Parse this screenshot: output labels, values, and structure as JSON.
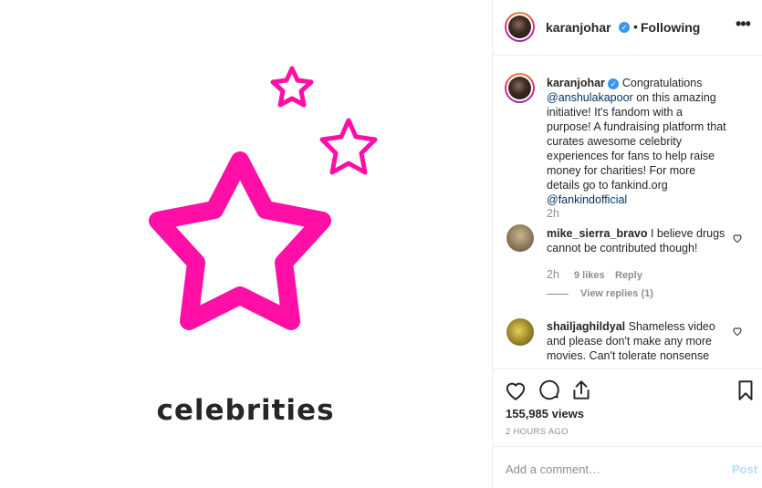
{
  "media": {
    "caption": "celebrities",
    "star_color": "#ff0fa6"
  },
  "header": {
    "username": "karanjohar",
    "verified_icon": "check",
    "separator": "•",
    "follow_status": "Following",
    "more_icon": "•••"
  },
  "caption": {
    "username": "karanjohar",
    "text_1": "Congratulations",
    "mention_1": "@anshulakapoor",
    "text_2": "on this amazing initiative! It's fandom with a purpose! A fundraising platform that curates awesome celebrity experiences for fans to help raise money for charities! For more details go to fankind.org",
    "mention_2": "@fankindofficial",
    "time": "2h"
  },
  "comments": [
    {
      "username": "mike_sierra_bravo",
      "text": "I believe drugs cannot be contributed though!",
      "time": "2h",
      "likes": "9 likes",
      "reply_label": "Reply",
      "view_replies": "View replies (1)"
    },
    {
      "username": "shailjaghildyal",
      "text": "Shameless video and please don't make any more movies. Can't tolerate nonsense"
    }
  ],
  "actions": {
    "views": "155,985 views",
    "posted_ago": "2 HOURS AGO"
  },
  "add_comment": {
    "placeholder": "Add a comment…",
    "post_label": "Post"
  },
  "colors": {
    "link": "#003569",
    "verified": "#3897f0",
    "muted": "#8e8e8e",
    "post_disabled": "#b2dffc"
  }
}
